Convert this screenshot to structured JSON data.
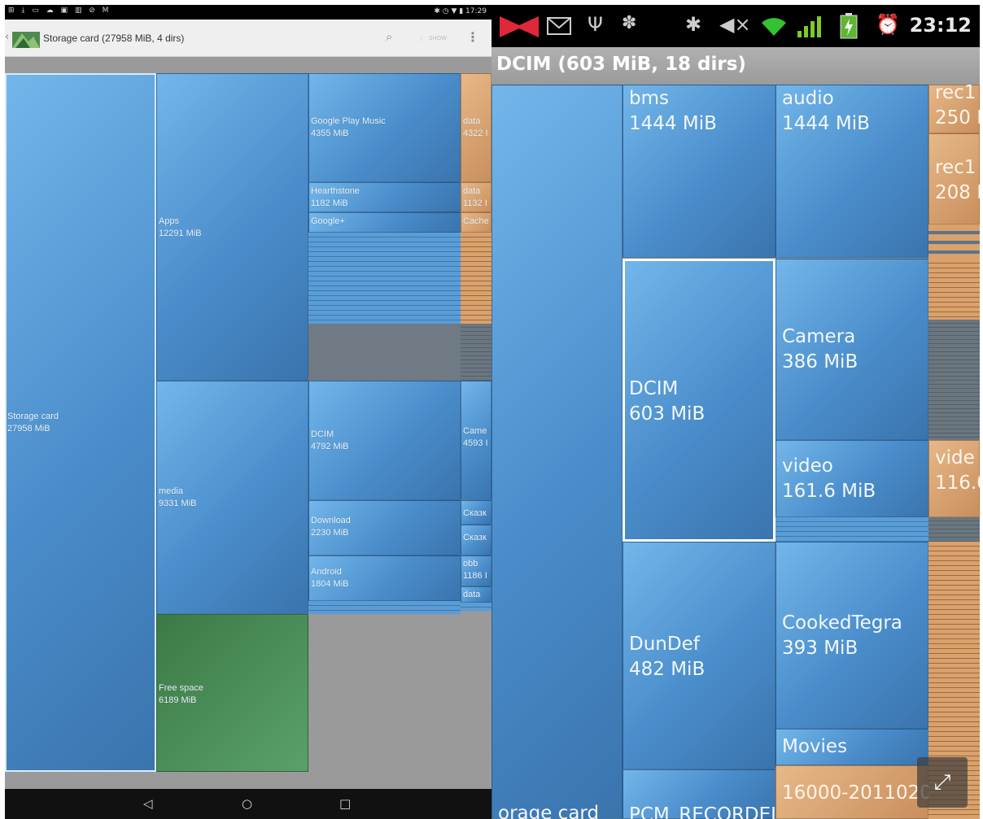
{
  "left_screen": {
    "status_bar": {
      "icons_left": "⊞ ⤓ ▭ ☁ ▣ ▥ ⊘ M",
      "right": "✱ ◷ ▼ ▮ 17:29"
    },
    "action_bar": {
      "back": "‹",
      "title": "Storage card (27958 MiB, 4 dirs)",
      "search": "⌕",
      "show": "SHOW",
      "menu": "⋮"
    },
    "nodes": {
      "storage": {
        "name": "Storage card",
        "size": "27958 MiB"
      },
      "apps": {
        "name": "Apps",
        "size": "12291 MiB"
      },
      "media": {
        "name": "media",
        "size": "9331 MiB"
      },
      "free": {
        "name": "Free space",
        "size": "6189 MiB"
      },
      "gpm": {
        "name": "Google Play Music",
        "size": "4355 MiB"
      },
      "hearth": {
        "name": "Hearthstone",
        "size": "1182 MiB"
      },
      "gplus": {
        "name": "Google+",
        "size": ""
      },
      "data1": {
        "name": "data",
        "size": "4322 I"
      },
      "data2": {
        "name": "data",
        "size": "1132 I"
      },
      "cache": {
        "name": "Cache",
        "size": ""
      },
      "dcim": {
        "name": "DCIM",
        "size": "4792 MiB"
      },
      "download": {
        "name": "Download",
        "size": "2230 MiB"
      },
      "android": {
        "name": "Android",
        "size": "1804 MiB"
      },
      "came": {
        "name": "Came",
        "size": "4593 I"
      },
      "skaz1": {
        "name": "Сказк",
        "size": ""
      },
      "skaz2": {
        "name": "Сказк",
        "size": ""
      },
      "obb": {
        "name": "obb",
        "size": "1186 I"
      },
      "data3": {
        "name": "data",
        "size": ""
      }
    },
    "nav_bar": {
      "back": "◁",
      "home": "○",
      "recents": "□"
    }
  },
  "right_screen": {
    "status_bar": {
      "time": "23:12"
    },
    "header": {
      "title": "DCIM (603 MiB, 18 dirs)"
    },
    "nodes": {
      "bms": {
        "name": "bms",
        "size": "1444 MiB"
      },
      "audio": {
        "name": "audio",
        "size": "1444 MiB"
      },
      "rec1": {
        "name": "rec1",
        "size": "250 I"
      },
      "rec2": {
        "name": "rec1",
        "size": "208 I"
      },
      "dcim": {
        "name": "DCIM",
        "size": "603 MiB"
      },
      "camera": {
        "name": "Camera",
        "size": "386 MiB"
      },
      "video": {
        "name": "video",
        "size": "161.6 MiB"
      },
      "video2": {
        "name": "vide",
        "size": "116.0"
      },
      "dundef": {
        "name": "DunDef",
        "size": "482 MiB"
      },
      "cooked": {
        "name": "CookedTegra",
        "size": "393 MiB"
      },
      "movies": {
        "name": "Movies",
        "size": ""
      },
      "n16000": {
        "name": "16000-2011020",
        "size": ""
      },
      "storage": {
        "name": "orage card",
        "size": ""
      },
      "pcm": {
        "name": "PCM_RECORDEI",
        "size": ""
      }
    },
    "fullscreen_icon": "⤢"
  },
  "colors": {
    "blue": "#4a8dcb",
    "tan": "#c98f5c",
    "green": "#4a8a55",
    "gray": "#6f7a84"
  }
}
